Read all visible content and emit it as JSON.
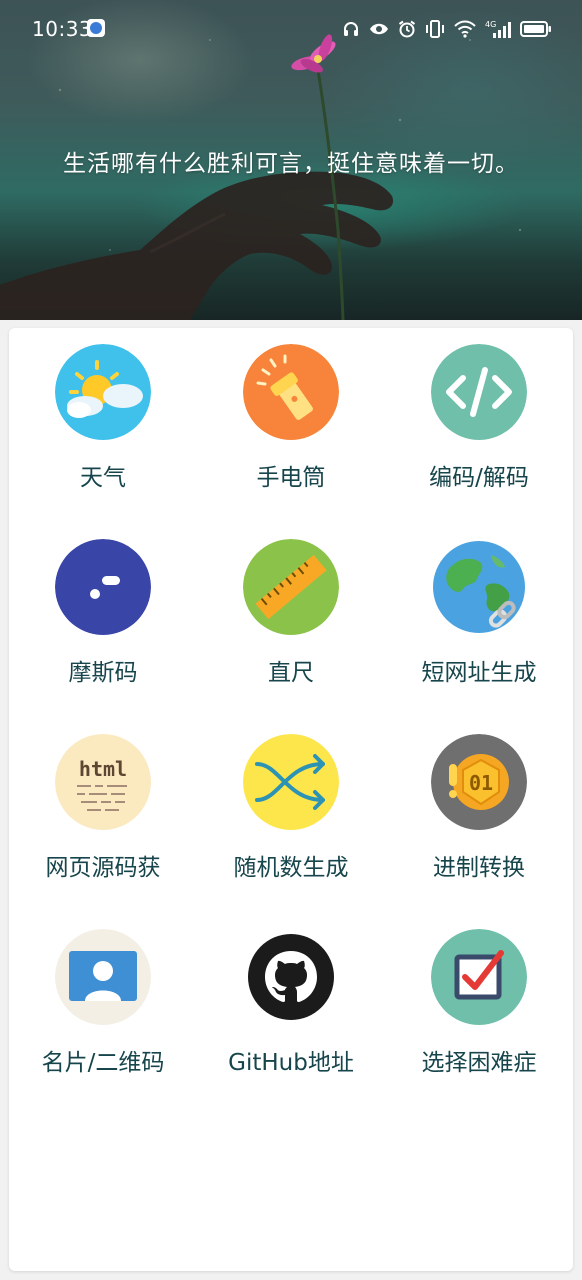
{
  "status_bar": {
    "time": "10:33",
    "icons": [
      "app-notification-icon",
      "headphones-icon",
      "eye-icon",
      "alarm-icon",
      "vibrate-icon",
      "wifi-icon",
      "signal-4g-icon",
      "battery-icon"
    ],
    "network_label": "4G"
  },
  "banner": {
    "quote": "生活哪有什么胜利可言，挺住意味着一切。"
  },
  "tools": [
    {
      "label": "天气",
      "icon": "weather-icon",
      "color": "#3fc1ec"
    },
    {
      "label": "手电筒",
      "icon": "flashlight-icon",
      "color": "#f7843a"
    },
    {
      "label": "编码/解码",
      "icon": "code-icon",
      "color": "#6fbfaa"
    },
    {
      "label": "摩斯码",
      "icon": "morse-code-icon",
      "color": "#3a45a8"
    },
    {
      "label": "直尺",
      "icon": "ruler-icon",
      "color": "#8bc34a"
    },
    {
      "label": "短网址生成",
      "icon": "globe-link-icon",
      "color": "#4aa3e0"
    },
    {
      "label": "网页源码获",
      "icon": "html-source-icon",
      "color": "#fbe9c0"
    },
    {
      "label": "随机数生成",
      "icon": "shuffle-icon",
      "color": "#fde64b"
    },
    {
      "label": "进制转换",
      "icon": "binary-coin-icon",
      "color": "#6f6f6f"
    },
    {
      "label": "名片/二维码",
      "icon": "contact-card-icon",
      "color": "#f3efe5"
    },
    {
      "label": "GitHub地址",
      "icon": "github-icon",
      "color": "#1b1b1b"
    },
    {
      "label": "选择困难症",
      "icon": "checkbox-icon",
      "color": "#6fbfaa"
    }
  ]
}
